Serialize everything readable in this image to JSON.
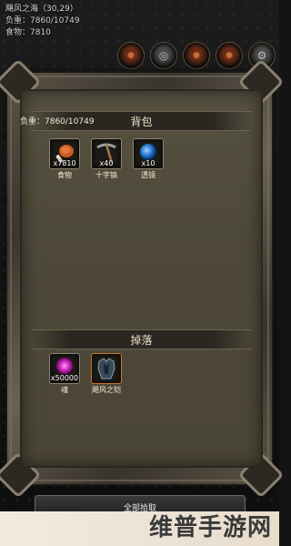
{
  "header": {
    "location": "飓风之海（30,29）",
    "load_line": "负重：7860/10749",
    "food_line": "食物：7810"
  },
  "top_icons": [
    "fire-icon",
    "target-icon",
    "fire-icon",
    "fire-icon",
    "gear-icon"
  ],
  "bag": {
    "title": "背包",
    "weight": "负重：7860/10749",
    "items": [
      {
        "name": "食物",
        "qty": "x7810",
        "icon": "meat-icon"
      },
      {
        "name": "十字镐",
        "qty": "x40",
        "icon": "pickaxe-icon"
      },
      {
        "name": "透镜",
        "qty": "x10",
        "icon": "lens-icon"
      }
    ]
  },
  "drop": {
    "title": "掉落",
    "items": [
      {
        "name": "魂",
        "qty": "x50000",
        "icon": "soul-icon"
      },
      {
        "name": "飓风之铠",
        "qty": "",
        "icon": "armor-icon"
      }
    ]
  },
  "collect_button": "全部拾取",
  "watermark": "维普手游网"
}
